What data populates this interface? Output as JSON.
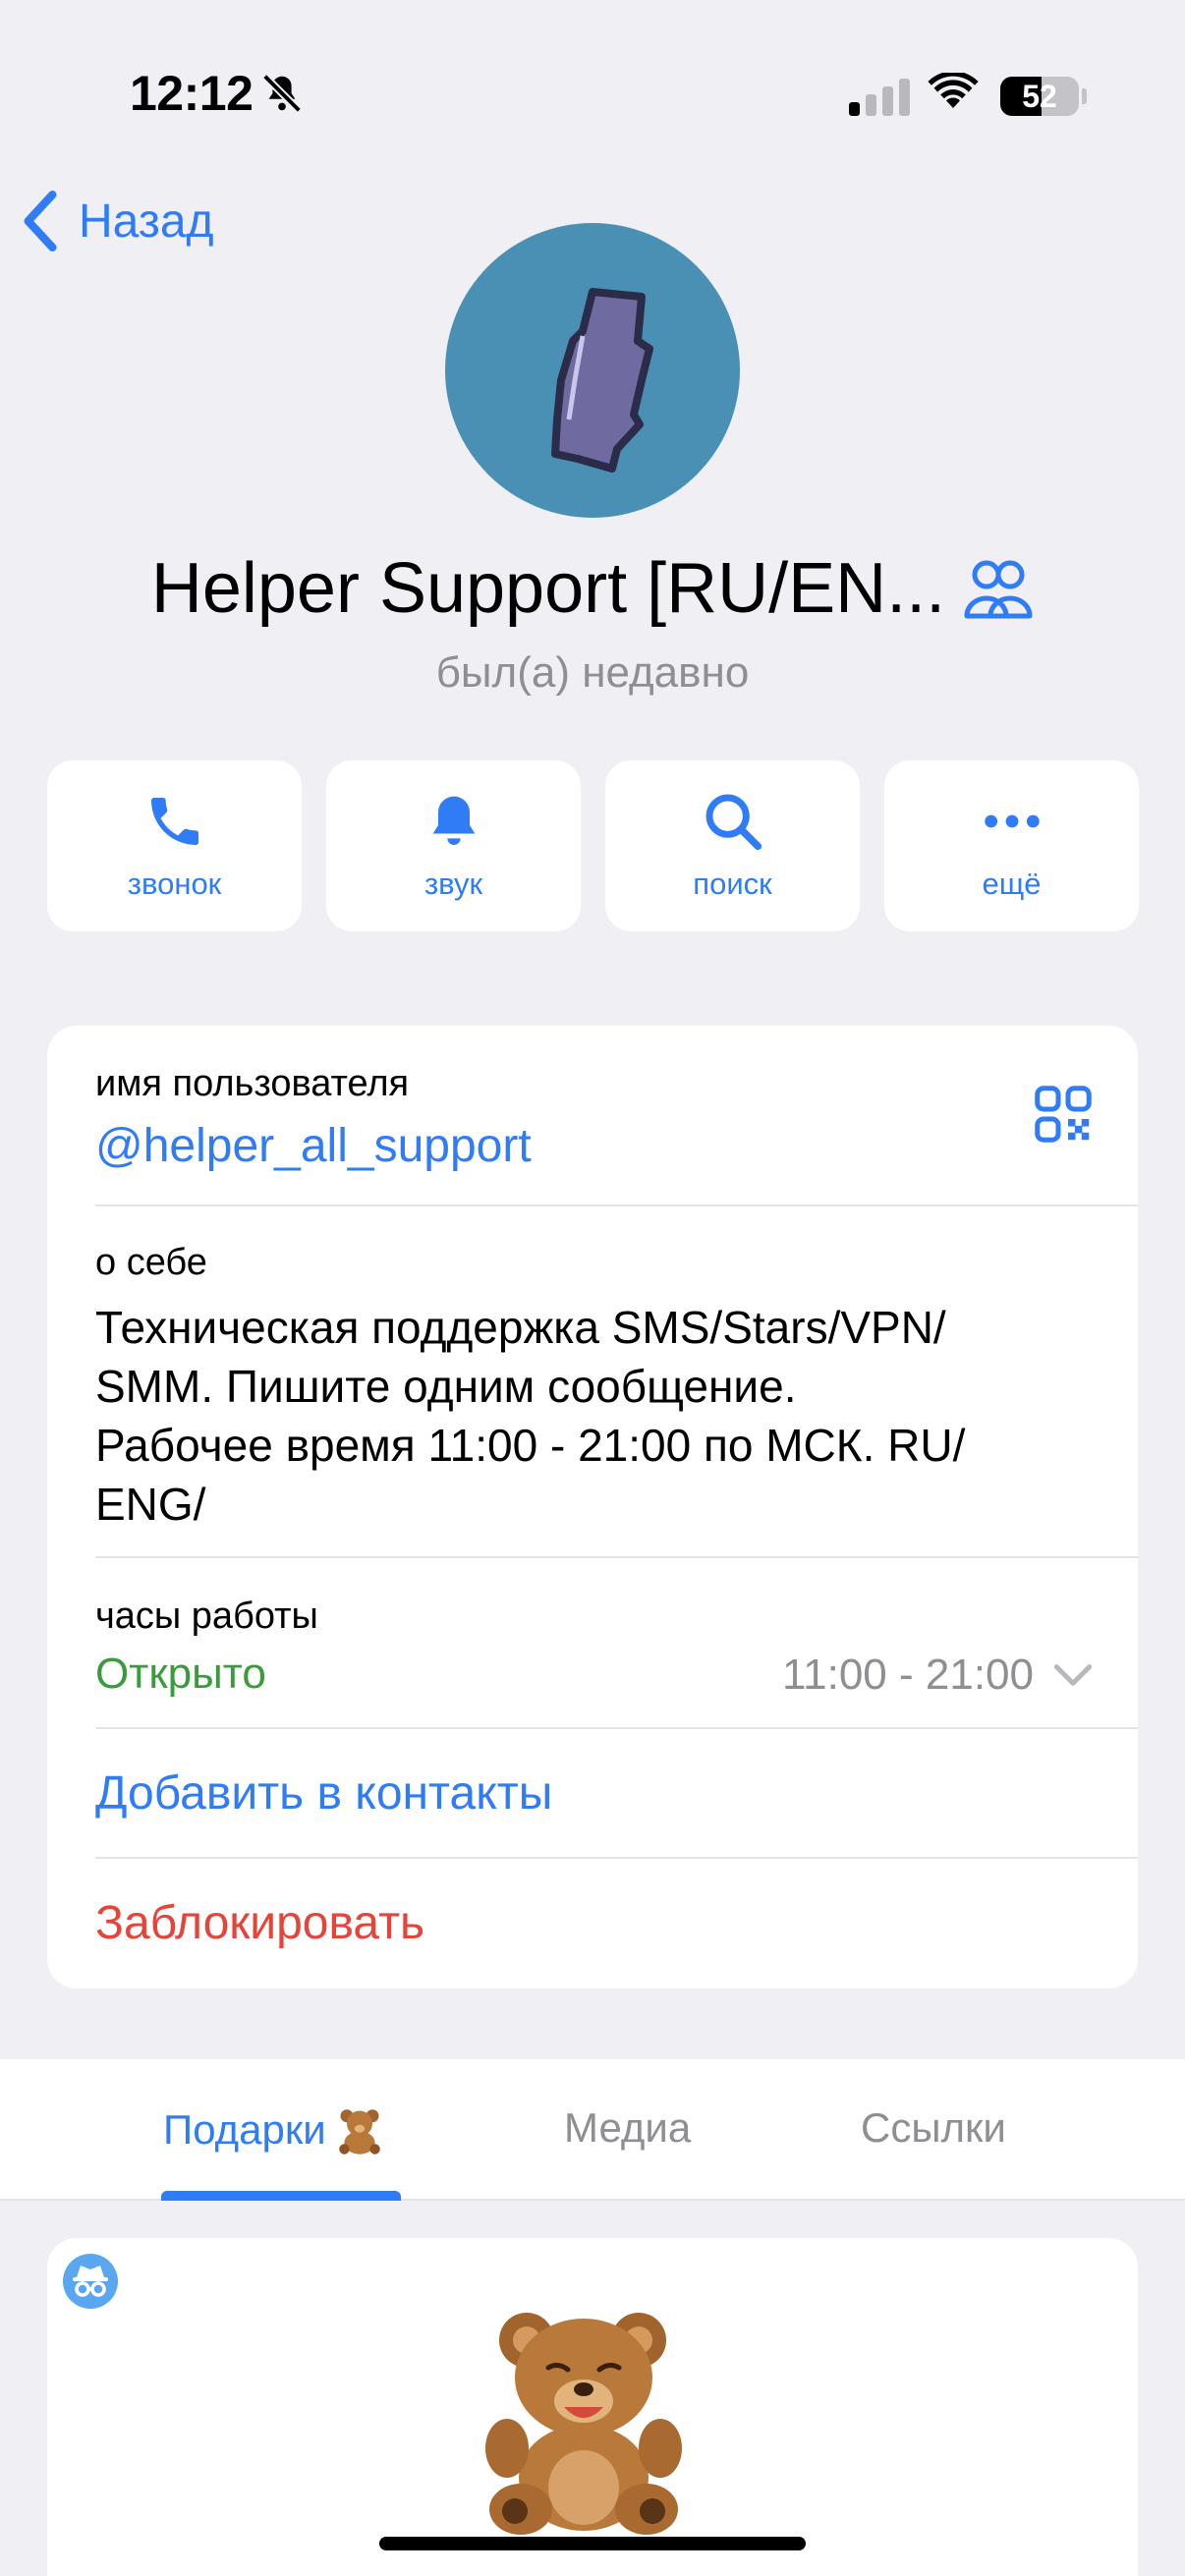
{
  "status_bar": {
    "time": "12:12",
    "battery": "52",
    "battery_level": 0.52
  },
  "nav": {
    "back_label": "Назад"
  },
  "profile": {
    "name": "Helper Support [RU/EN...",
    "status": "был(а) недавно"
  },
  "actions": [
    {
      "label": "звонок",
      "icon": "phone-icon"
    },
    {
      "label": "звук",
      "icon": "bell-icon"
    },
    {
      "label": "поиск",
      "icon": "search-icon"
    },
    {
      "label": "ещё",
      "icon": "more-icon"
    }
  ],
  "info": {
    "username_label": "имя пользователя",
    "username": "@helper_all_support",
    "bio_label": "о себе",
    "bio_lines": [
      "Техническая поддержка SMS/Stars/VPN/",
      "SMM. Пишите одним сообщение.",
      "Рабочее время 11:00 - 21:00 по МСК. RU/",
      "ENG/"
    ],
    "hours_label": "часы работы",
    "hours_status": "Открыто",
    "hours_range": "11:00 - 21:00",
    "add_contact": "Добавить в контакты",
    "block": "Заблокировать"
  },
  "tabs": [
    {
      "label": "Подарки",
      "active": true
    },
    {
      "label": "Медиа",
      "active": false
    },
    {
      "label": "Ссылки",
      "active": false
    }
  ],
  "colors": {
    "accent": "#2f7cf6",
    "open": "#3b9a3c",
    "danger": "#e4443a",
    "avatar_bg": "#4a90b4"
  }
}
